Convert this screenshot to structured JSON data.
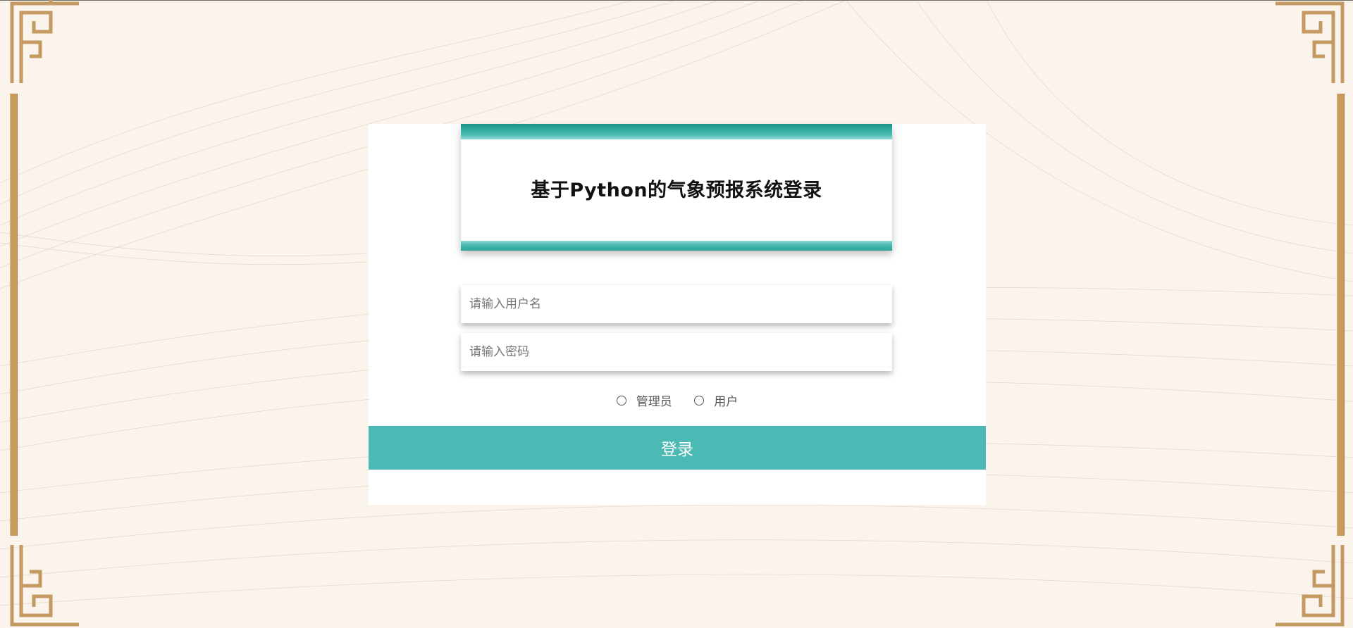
{
  "title": "基于Python的气象预报系统登录",
  "form": {
    "username_placeholder": "请输入用户名",
    "password_placeholder": "请输入密码",
    "roles": [
      {
        "label": "管理员",
        "selected": false
      },
      {
        "label": "用户",
        "selected": false
      }
    ],
    "login_label": "登录"
  },
  "colors": {
    "accent": "#4bbab5",
    "band_dark": "#17958a",
    "frame_gold": "#c89a5c",
    "background": "#faf4ec"
  },
  "icons": {
    "corner_ornament": "fret-corner-ornament",
    "radio": "radio-unchecked-icon"
  }
}
